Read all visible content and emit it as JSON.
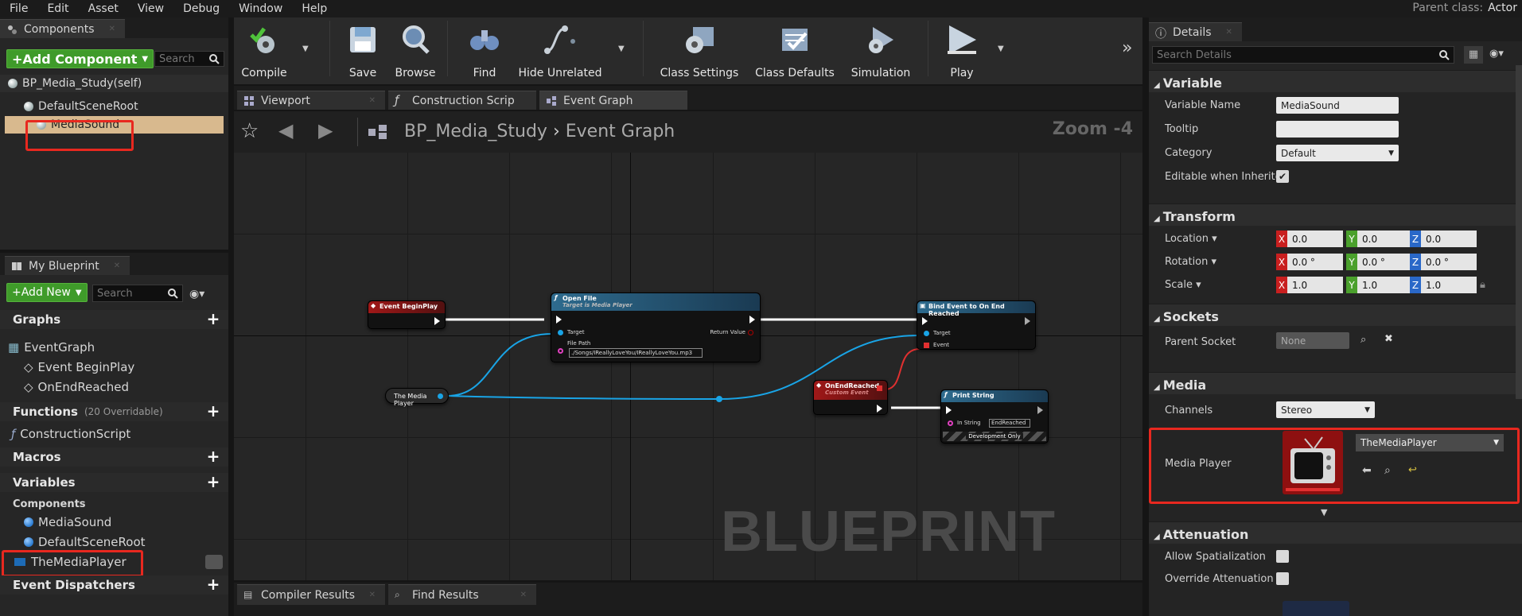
{
  "menu": [
    "File",
    "Edit",
    "Asset",
    "View",
    "Debug",
    "Window",
    "Help"
  ],
  "parent_class": {
    "label": "Parent class:",
    "value": "Actor"
  },
  "components_panel": {
    "title": "Components",
    "add_component": "+Add Component",
    "search_placeholder": "Search",
    "self_item": "BP_Media_Study(self)",
    "root": "DefaultSceneRoot",
    "child": "MediaSound"
  },
  "my_blueprint": {
    "title": "My Blueprint",
    "add_new": "+Add New",
    "search_placeholder": "Search",
    "graphs_label": "Graphs",
    "event_graph": "EventGraph",
    "events": [
      "Event BeginPlay",
      "OnEndReached"
    ],
    "functions_label": "Functions",
    "functions_count": "(20 Overridable)",
    "construction_script": "ConstructionScript",
    "macros_label": "Macros",
    "variables_label": "Variables",
    "components_label": "Components",
    "var_components": [
      "MediaSound",
      "DefaultSceneRoot"
    ],
    "media_player_var": "TheMediaPlayer",
    "dispatchers_label": "Event Dispatchers"
  },
  "toolbar": [
    "Compile",
    "Save",
    "Browse",
    "Find",
    "Hide Unrelated",
    "Class Settings",
    "Class Defaults",
    "Simulation",
    "Play"
  ],
  "editor_tabs": [
    "Viewport",
    "Construction Scrip",
    "Event Graph"
  ],
  "breadcrumb": {
    "blueprint": "BP_Media_Study",
    "graph": "Event Graph",
    "zoom": "Zoom -4"
  },
  "graph": {
    "watermark": "BLUEPRINT",
    "nodes": {
      "begin_play": "Event BeginPlay",
      "open_file": "Open File",
      "open_file_sub": "Target is Media Player",
      "target": "Target",
      "return_value": "Return Value",
      "file_path": "File Path",
      "file_path_value": "./Songs/IReallyLoveYou/IReallyLoveYou.mp3",
      "media_player_ref": "The Media Player",
      "bind_event": "Bind Event to On End Reached",
      "event": "Event",
      "on_end_reached": "OnEndReached",
      "custom_event": "Custom Event",
      "print_string": "Print String",
      "in_string": "In String",
      "in_string_value": "EndReached",
      "dev_only": "Development Only"
    }
  },
  "bottom_tabs": [
    "Compiler Results",
    "Find Results"
  ],
  "details": {
    "title": "Details",
    "search_placeholder": "Search Details",
    "variable_section": "Variable",
    "variable_name_label": "Variable Name",
    "variable_name": "MediaSound",
    "tooltip_label": "Tooltip",
    "category_label": "Category",
    "category": "Default",
    "editable_label": "Editable when Inherited",
    "transform_section": "Transform",
    "location_label": "Location",
    "location": [
      "0.0",
      "0.0",
      "0.0"
    ],
    "rotation_label": "Rotation",
    "rotation": [
      "0.0 °",
      "0.0 °",
      "0.0 °"
    ],
    "scale_label": "Scale",
    "scale": [
      "1.0",
      "1.0",
      "1.0"
    ],
    "sockets_section": "Sockets",
    "parent_socket_label": "Parent Socket",
    "parent_socket": "None",
    "media_section": "Media",
    "channels_label": "Channels",
    "channels": "Stereo",
    "media_player_label": "Media Player",
    "media_player_value": "TheMediaPlayer",
    "attenuation_section": "Attenuation",
    "allow_spatialization_label": "Allow Spatialization",
    "override_attenuation_label": "Override Attenuation"
  },
  "colors": {
    "accent_red": "#e8281f",
    "green_button": "#3f9b2a",
    "event_node": "#8b1414",
    "function_node": "#2c5a7a",
    "wire_blue": "#19a4e6"
  }
}
